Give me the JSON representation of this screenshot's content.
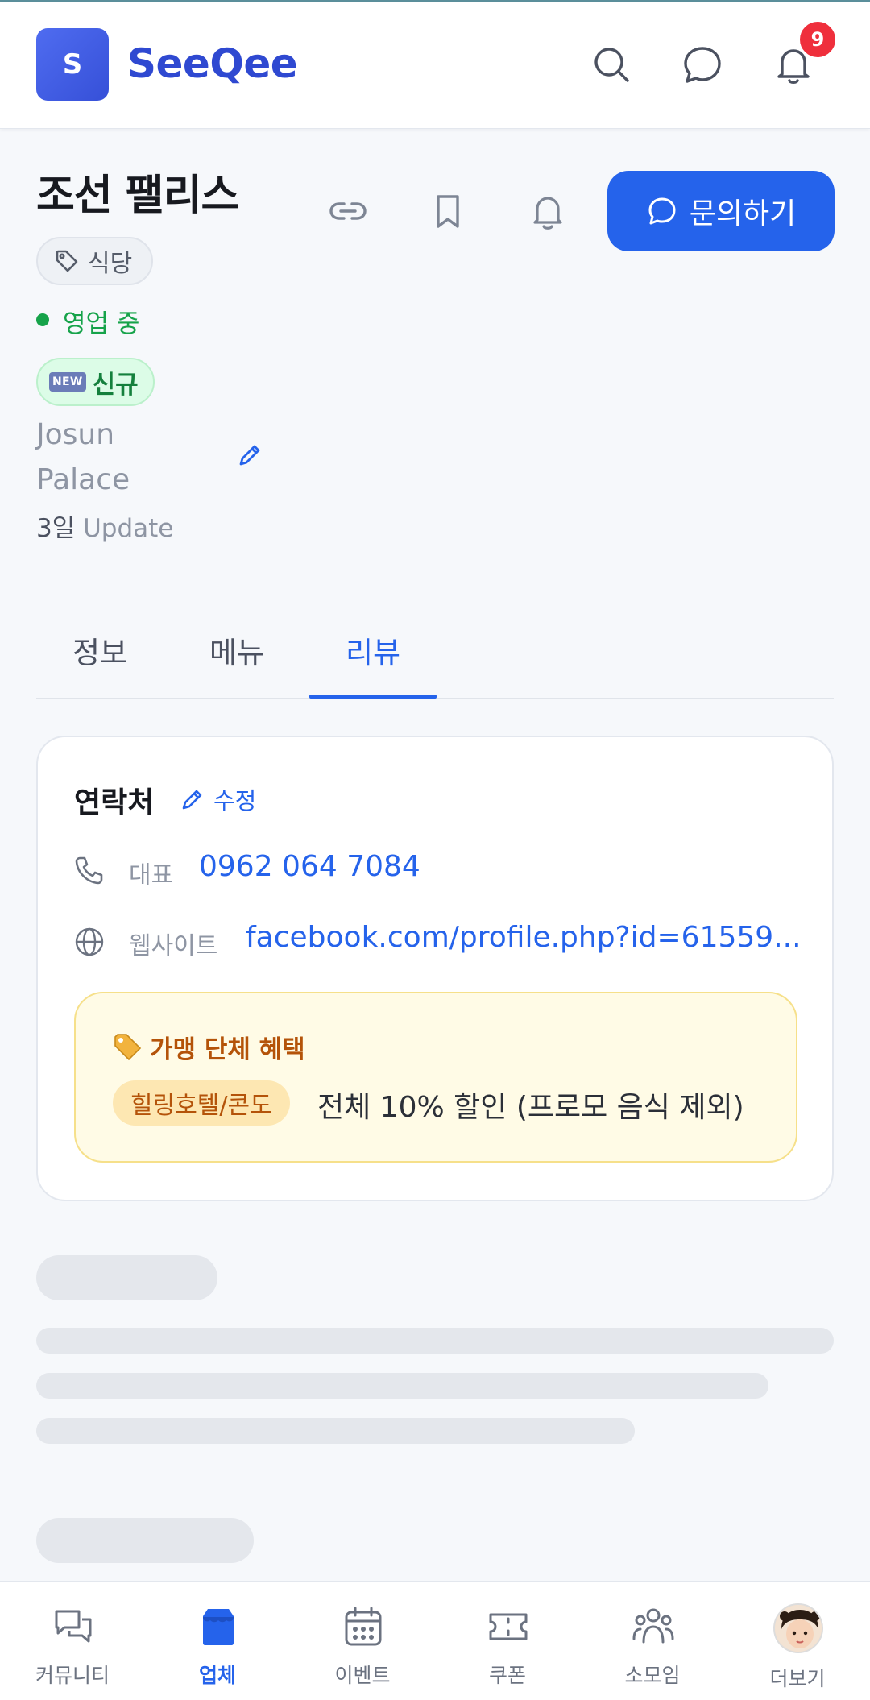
{
  "header": {
    "logo_letter": "S",
    "app_name": "SeeQee",
    "notification_count": "9",
    "icons": [
      "search-icon",
      "chat-icon",
      "bell-icon"
    ]
  },
  "business": {
    "name": "조선 팰리스",
    "category": "식당",
    "status": "영업 중",
    "new_badge": "NEW",
    "new_label": "신규",
    "english_name": "Josun Palace",
    "updated_num": "3일",
    "updated_label": "Update",
    "inquiry_label": "문의하기",
    "colors": {
      "primary": "#2563eb",
      "open": "#16a34a"
    }
  },
  "tabs": [
    {
      "label": "정보",
      "active": false
    },
    {
      "label": "메뉴",
      "active": false
    },
    {
      "label": "리뷰",
      "active": true
    }
  ],
  "contact": {
    "title": "연락처",
    "edit_label": "수정",
    "phone_label": "대표",
    "phone": "0962 064 7084",
    "website_label": "웹사이트",
    "website": "facebook.com/profile.php?id=61559..."
  },
  "benefit": {
    "title": "가맹 단체 혜택",
    "group": "힐링호텔/콘도",
    "text": "전체 10% 할인 (프로모 음식 제외)"
  },
  "bottom_nav": [
    {
      "label": "커뮤니티",
      "icon": "community-icon",
      "active": false
    },
    {
      "label": "업체",
      "icon": "store-icon",
      "active": true
    },
    {
      "label": "이벤트",
      "icon": "calendar-icon",
      "active": false
    },
    {
      "label": "쿠폰",
      "icon": "ticket-icon",
      "active": false
    },
    {
      "label": "소모임",
      "icon": "group-icon",
      "active": false
    },
    {
      "label": "더보기",
      "icon": "avatar",
      "active": false
    }
  ]
}
